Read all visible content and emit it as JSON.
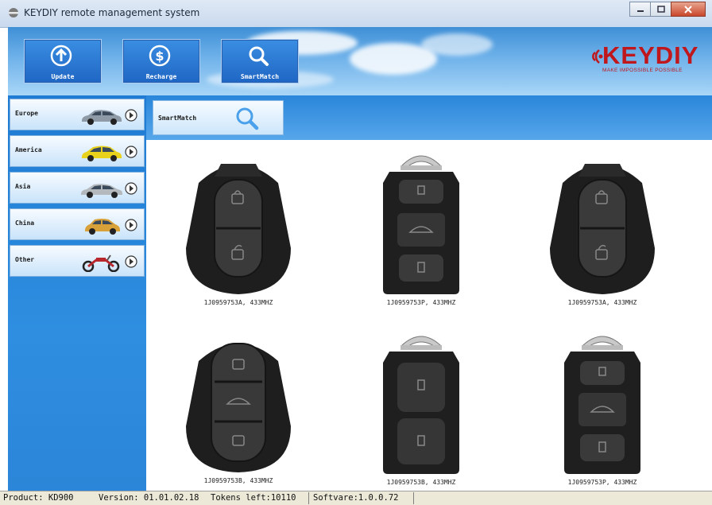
{
  "window": {
    "title": "KEYDIY remote management system",
    "icons": [
      "minimize-icon",
      "maximize-icon",
      "close-icon"
    ]
  },
  "toolbar": {
    "buttons": [
      {
        "label": "Update",
        "icon": "upload-icon"
      },
      {
        "label": "Recharge",
        "icon": "dollar-icon"
      },
      {
        "label": "SmartMatch",
        "icon": "search-icon"
      }
    ]
  },
  "logo": {
    "brand": "KEYDIY",
    "tagline": "MAKE IMPOSSIBLE POSSIBLE",
    "color": "#c0171c"
  },
  "sidebar": {
    "regions": [
      {
        "label": "Europe",
        "icon": "car-icon"
      },
      {
        "label": "America",
        "icon": "car-icon"
      },
      {
        "label": "Asia",
        "icon": "car-icon"
      },
      {
        "label": "China",
        "icon": "car-icon"
      },
      {
        "label": "Other",
        "icon": "motorcycle-icon"
      }
    ]
  },
  "main": {
    "tab": {
      "label": "SmartMatch",
      "icon": "search-icon"
    },
    "keys": [
      {
        "part": "1J0959753A, 433MHZ",
        "buttons": 2
      },
      {
        "part": "1J0959753P, 433MHZ",
        "buttons": 3
      },
      {
        "part": "1J0959753A, 433MHZ",
        "buttons": 2
      },
      {
        "part": "1J0959753B, 433MHZ",
        "buttons": 3
      },
      {
        "part": "1J0959753B, 433MHZ",
        "buttons": 2
      },
      {
        "part": "1J0959753P, 433MHZ",
        "buttons": 3
      }
    ]
  },
  "status": {
    "product": "Product: KD900",
    "version": "Version: 01.01.02.18",
    "tokens": "Tokens left:10110",
    "software": "Softvare:1.0.0.72"
  }
}
